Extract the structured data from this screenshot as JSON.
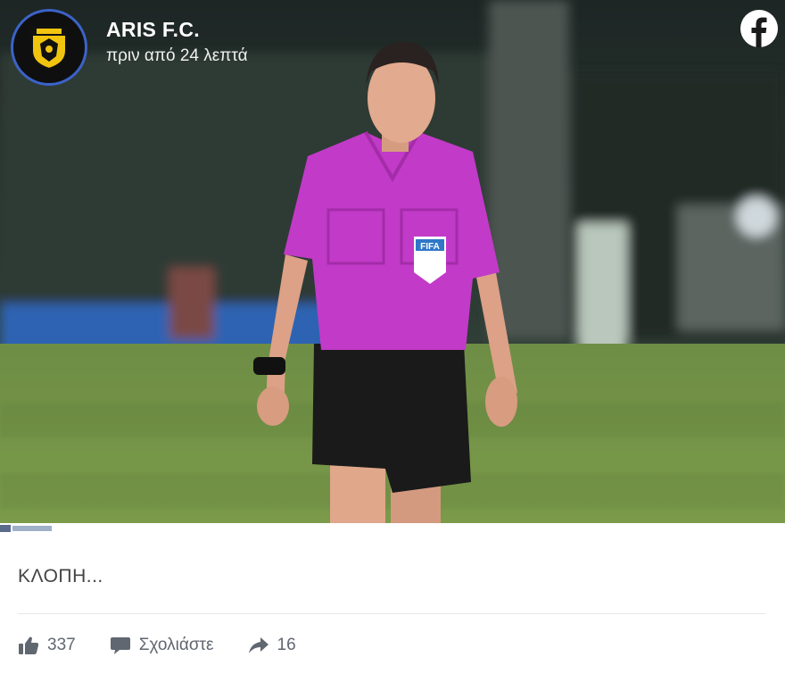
{
  "post": {
    "page_name": "ARIS F.C.",
    "timestamp": "πριν από 24 λεπτά",
    "text": "ΚΛΟΠΗ...",
    "photo_badge": "FIFA"
  },
  "actions": {
    "like_count": "337",
    "comment_label": "Σχολιάστε",
    "share_count": "16"
  },
  "icons": {
    "social": "facebook-icon",
    "like": "thumbs-up-icon",
    "comment": "comment-icon",
    "share": "share-arrow-icon"
  },
  "colors": {
    "avatar_ring": "#3b63c8",
    "text_muted": "#606770",
    "jersey": "#c23ac8"
  }
}
